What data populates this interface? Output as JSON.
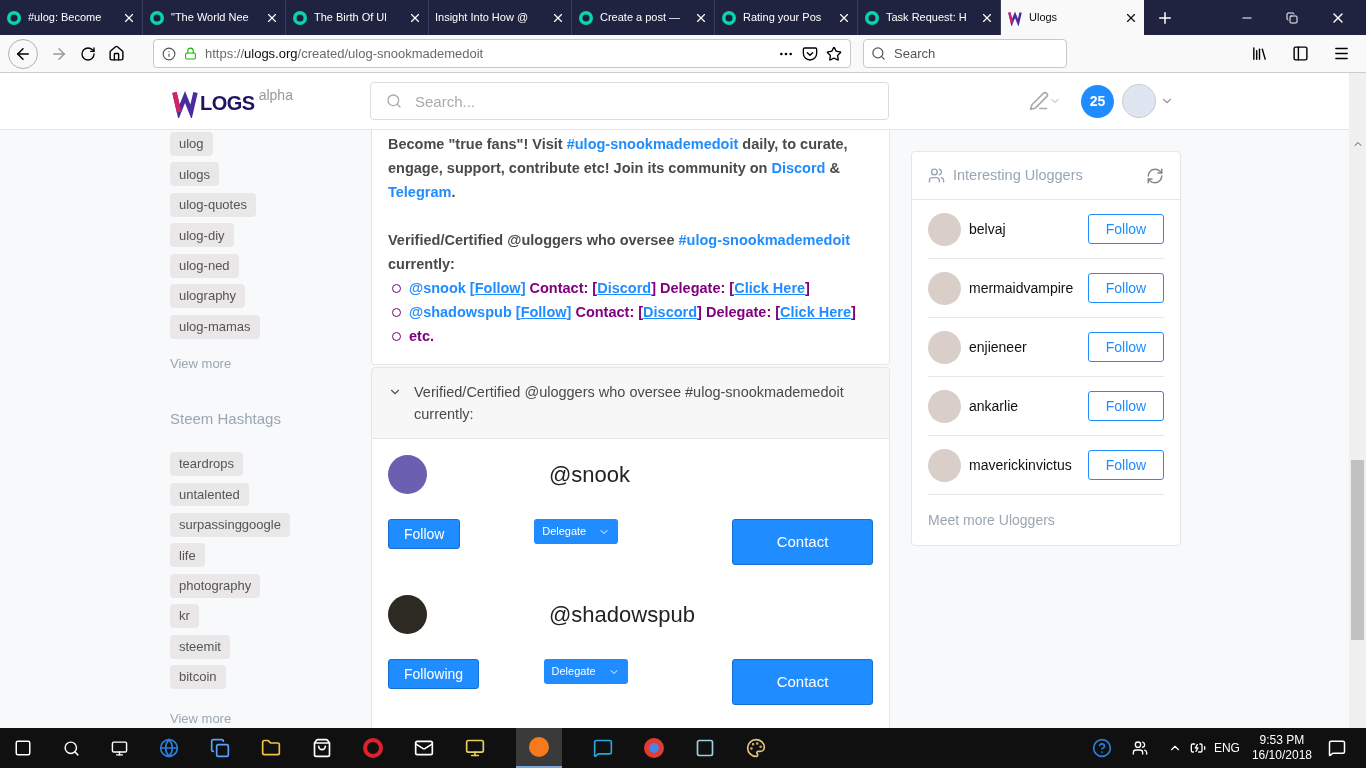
{
  "browser": {
    "tabs": [
      {
        "title": "#ulog: Become",
        "kind": "site",
        "selected": false
      },
      {
        "title": "\"The World Nee",
        "kind": "site",
        "selected": false
      },
      {
        "title": "The Birth Of Ul",
        "kind": "site",
        "selected": false
      },
      {
        "title": "Insight Into How @",
        "kind": "blank",
        "selected": false
      },
      {
        "title": "Create a post —",
        "kind": "site",
        "selected": false
      },
      {
        "title": "Rating your Pos",
        "kind": "site",
        "selected": false
      },
      {
        "title": "Task Request: H",
        "kind": "site",
        "selected": false
      },
      {
        "title": "Ulogs",
        "kind": "ulogs",
        "selected": true
      }
    ],
    "url_scheme": "https://",
    "url_host": "ulogs.org",
    "url_path": "/created/ulog-snookmademedoit",
    "search_placeholder": "Search"
  },
  "header": {
    "logo": "LOGS",
    "badge": "alpha",
    "search_placeholder": "Search...",
    "notifications": "25"
  },
  "sidebar": {
    "ulog_tags": [
      "ulog",
      "ulogs",
      "ulog-quotes",
      "ulog-diy",
      "ulog-ned",
      "ulography",
      "ulog-mamas"
    ],
    "view_more_1": "View more",
    "heading": "Steem Hashtags",
    "steem_tags": [
      "teardrops",
      "untalented",
      "surpassinggoogle",
      "life",
      "photography",
      "kr",
      "steemit",
      "bitcoin"
    ],
    "view_more_2": "View more"
  },
  "post": {
    "paragraphs": [
      [
        {
          "kind": "text",
          "text": "Become \"true fans\"! Visit "
        },
        {
          "kind": "tag",
          "text": "#ulog-snookmademedoit"
        },
        {
          "kind": "text",
          "text": " daily, to curate, engage, support, contribute etc! Join its community on "
        },
        {
          "kind": "tag",
          "text": "Discord"
        },
        {
          "kind": "text",
          "text": " & "
        },
        {
          "kind": "tag",
          "text": "Telegram"
        },
        {
          "kind": "text",
          "text": "."
        }
      ],
      [
        {
          "kind": "text",
          "text": "Verified/Certified @uloggers who oversee "
        },
        {
          "kind": "tag",
          "text": "#ulog-snookmademedoit"
        },
        {
          "kind": "text",
          "text": " currently:"
        }
      ]
    ],
    "list": [
      [
        {
          "kind": "tag",
          "text": "@snook"
        },
        {
          "kind": "tag",
          "text": " ["
        },
        {
          "kind": "link",
          "text": "Follow"
        },
        {
          "kind": "tag",
          "text": "]"
        },
        {
          "kind": "text",
          "text": " Contact: ["
        },
        {
          "kind": "link",
          "text": "Discord"
        },
        {
          "kind": "text",
          "text": "] Delegate: ["
        },
        {
          "kind": "link",
          "text": "Click Here"
        },
        {
          "kind": "text",
          "text": "]"
        }
      ],
      [
        {
          "kind": "tag",
          "text": "@shadowspub"
        },
        {
          "kind": "tag",
          "text": " ["
        },
        {
          "kind": "link",
          "text": "Follow"
        },
        {
          "kind": "tag",
          "text": "]"
        },
        {
          "kind": "text",
          "text": " Contact: ["
        },
        {
          "kind": "link",
          "text": "Discord"
        },
        {
          "kind": "text",
          "text": "] Delegate: ["
        },
        {
          "kind": "link",
          "text": "Click Here"
        },
        {
          "kind": "text",
          "text": "]"
        }
      ],
      [
        {
          "kind": "text",
          "text": "etc."
        }
      ]
    ]
  },
  "accordion": {
    "title": "Verified/Certified @uloggers who oversee #ulog-snookmademedoit currently:",
    "expanded": true
  },
  "members": [
    {
      "handle": "@snook",
      "follow": "Follow",
      "delegate": "Delegate",
      "contact": "Contact"
    },
    {
      "handle": "@shadowspub",
      "follow": "Following",
      "delegate": "Delegate",
      "contact": "Contact"
    }
  ],
  "widget": {
    "title": "Interesting Uloggers",
    "users": [
      {
        "name": "belvaj",
        "button": "Follow"
      },
      {
        "name": "mermaidvampire",
        "button": "Follow"
      },
      {
        "name": "enjieneer",
        "button": "Follow"
      },
      {
        "name": "ankarlie",
        "button": "Follow"
      },
      {
        "name": "maverickinvictus",
        "button": "Follow"
      }
    ],
    "more": "Meet more Uloggers"
  },
  "taskbar": {
    "language": "ENG",
    "time": "9:53 PM",
    "date": "16/10/2018"
  }
}
